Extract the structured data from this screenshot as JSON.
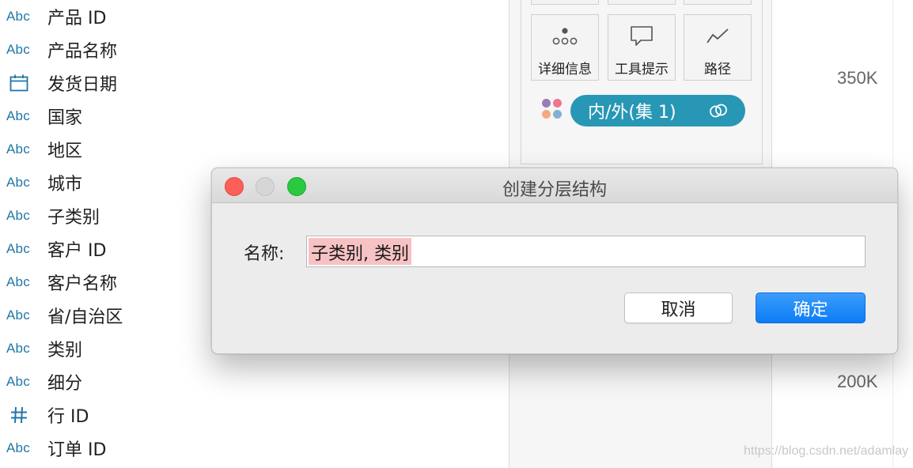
{
  "field_list": [
    {
      "type": "Abc",
      "label": "产品 ID"
    },
    {
      "type": "Abc",
      "label": "产品名称"
    },
    {
      "type": "calendar-icon",
      "label": "发货日期"
    },
    {
      "type": "Abc",
      "label": "国家"
    },
    {
      "type": "Abc",
      "label": "地区"
    },
    {
      "type": "Abc",
      "label": "城市"
    },
    {
      "type": "Abc",
      "label": "子类别"
    },
    {
      "type": "Abc",
      "label": "客户 ID"
    },
    {
      "type": "Abc",
      "label": "客户名称"
    },
    {
      "type": "Abc",
      "label": "省/自治区"
    },
    {
      "type": "Abc",
      "label": "类别"
    },
    {
      "type": "Abc",
      "label": "细分"
    },
    {
      "type": "hash-icon",
      "label": "行 ID"
    },
    {
      "type": "Abc",
      "label": "订单 ID"
    }
  ],
  "marks": {
    "buttons": [
      {
        "label": "详细信息",
        "icon": "detail-dots-icon"
      },
      {
        "label": "工具提示",
        "icon": "tooltip-bubble-icon"
      },
      {
        "label": "路径",
        "icon": "path-line-icon"
      }
    ],
    "pill": {
      "label": "内/外(集 1)",
      "icon": "set-link-icon",
      "color": "#2897b5"
    },
    "color_dots": [
      "#9b7bb3",
      "#f0758f",
      "#f6a97d",
      "#7fb1d6"
    ]
  },
  "axis": {
    "labels": [
      "350K",
      "200K"
    ]
  },
  "watermark": "https://blog.csdn.net/adamlay",
  "dialog": {
    "title": "创建分层结构",
    "name_label": "名称:",
    "name_value": "子类别, 类别",
    "cancel_label": "取消",
    "ok_label": "确定",
    "accent": "#0d7cf5"
  }
}
